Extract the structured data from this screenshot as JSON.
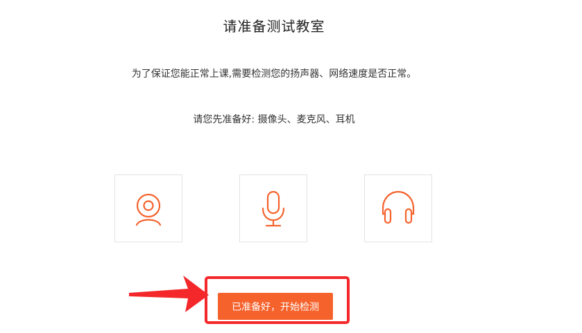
{
  "page": {
    "title": "请准备测试教室",
    "description": "为了保证您能正常上课,需要检测您的扬声器、网络速度是否正常。",
    "preparation": "请您先准备好: 摄像头、麦克风、耳机"
  },
  "devices": [
    {
      "icon": "camera-icon"
    },
    {
      "icon": "microphone-icon"
    },
    {
      "icon": "headset-icon"
    }
  ],
  "actions": {
    "start_label": "已准备好，开始检测"
  },
  "colors": {
    "accent": "#f5622c",
    "annotation_red": "#f4272a",
    "box_border": "#e2e2e2"
  }
}
